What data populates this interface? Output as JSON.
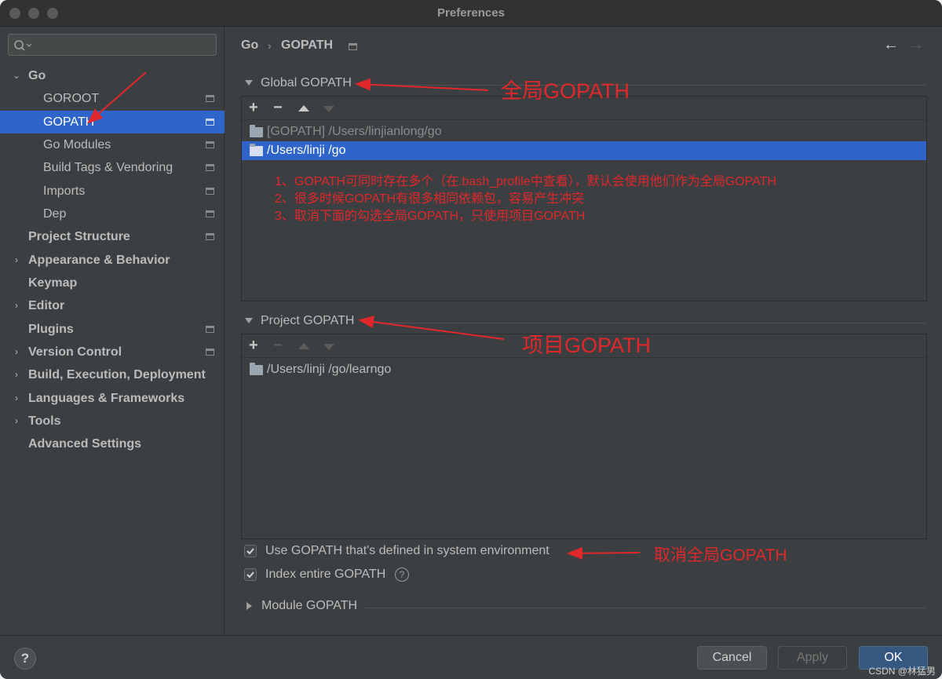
{
  "window": {
    "title": "Preferences"
  },
  "search": {
    "placeholder": ""
  },
  "sidebar": {
    "items": [
      {
        "label": "Go",
        "bold": true,
        "expanded": true
      },
      {
        "label": "GOROOT"
      },
      {
        "label": "GOPATH",
        "selected": true
      },
      {
        "label": "Go Modules"
      },
      {
        "label": "Build Tags & Vendoring"
      },
      {
        "label": "Imports"
      },
      {
        "label": "Dep"
      },
      {
        "label": "Project Structure"
      },
      {
        "label": "Appearance & Behavior"
      },
      {
        "label": "Keymap"
      },
      {
        "label": "Editor"
      },
      {
        "label": "Plugins"
      },
      {
        "label": "Version Control"
      },
      {
        "label": "Build, Execution, Deployment"
      },
      {
        "label": "Languages & Frameworks"
      },
      {
        "label": "Tools"
      },
      {
        "label": "Advanced Settings"
      }
    ]
  },
  "breadcrumb": {
    "parent": "Go",
    "separator": "›",
    "current": "GOPATH"
  },
  "nav": {
    "back": "←",
    "forward": "→"
  },
  "global_gopath": {
    "title": "Global GOPATH",
    "toolbar": {
      "add": "+",
      "remove": "−"
    },
    "rows": [
      {
        "path": "[GOPATH] /Users/linjianlong/go"
      },
      {
        "path": "/Users/linji     /go"
      }
    ]
  },
  "project_gopath": {
    "title": "Project GOPATH",
    "toolbar": {
      "add": "+",
      "remove": "−"
    },
    "rows": [
      {
        "path": "/Users/linji     /go/learngo"
      }
    ]
  },
  "options": {
    "use_system_env": {
      "label": "Use GOPATH that's defined in system environment",
      "checked": true
    },
    "index_entire": {
      "label": "Index entire GOPATH",
      "checked": true,
      "help": "?"
    }
  },
  "module_gopath": {
    "title": "Module GOPATH"
  },
  "annotations": {
    "global": "全局GOPATH",
    "project": "项目GOPATH",
    "cancel_global": "取消全局GOPATH",
    "notes": [
      "1、GOPATH可同时存在多个（在.bash_profile中查看），默认会使用他们作为全局GOPATH",
      "2、很多时候GOPATH有很多相同依赖包，容易产生冲突",
      "3、取消下面的勾选全局GOPATH，只使用项目GOPATH"
    ]
  },
  "footer": {
    "help": "?",
    "cancel": "Cancel",
    "apply": "Apply",
    "ok": "OK",
    "watermark": "CSDN @林猛男"
  },
  "colors": {
    "accent": "#2f65ca",
    "annotation": "#e0272b",
    "background": "#3c3f41"
  }
}
